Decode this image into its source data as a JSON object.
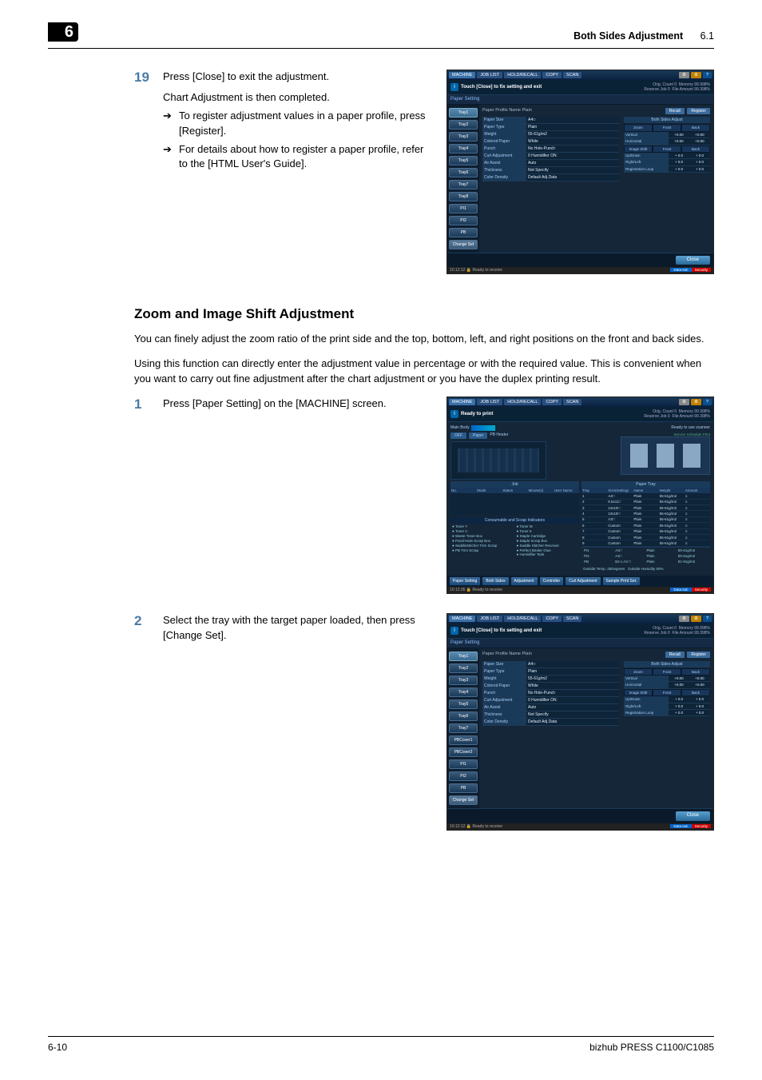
{
  "header": {
    "title": "Both Sides Adjustment",
    "section": "6.1"
  },
  "chapter_tab": "6",
  "footer": {
    "page": "6-10",
    "product": "bizhub PRESS C1100/C1085"
  },
  "step19": {
    "num": "19",
    "line1": "Press [Close] to exit the adjustment.",
    "line2": "Chart Adjustment is then completed.",
    "bullet1": "To register adjustment values in a paper profile, press [Register].",
    "bullet2": "For details about how to register a paper profile, refer to the [HTML User's Guide]."
  },
  "section_title": "Zoom and Image Shift Adjustment",
  "para1": "You can finely adjust the zoom ratio of the print side and the top, bottom, left, and right positions on the front and back sides.",
  "para2": "Using this function can directly enter the adjustment value in percentage or with the required value. This is convenient when you want to carry out fine adjustment after the chart adjustment or you have the duplex printing result.",
  "step1": {
    "num": "1",
    "text": "Press [Paper Setting] on the [MACHINE] screen."
  },
  "step2": {
    "num": "2",
    "text": "Select the tray with the target paper loaded, then press [Change Set]."
  },
  "screen_common": {
    "tabs": {
      "machine": "MACHINE",
      "joblist": "JOB LIST",
      "recall": "HOLD/RECALL",
      "copy": "COPY",
      "scan": "SCAN",
      "util": "Utility",
      "help": "?"
    },
    "stats": {
      "orig_label": "Orig. Count",
      "orig_val": "0",
      "mem_label": "Memory",
      "mem_val": "99.998%",
      "res_label": "Reserve Job",
      "res_val": "0",
      "file_label": "File Amount",
      "file_val": "99.398%"
    },
    "status_time": "10:12:12",
    "status_text": "Ready to receive",
    "led_blue": "Data Ind.",
    "led_red": "Security"
  },
  "screen1": {
    "msg": "Touch [Close] to fix setting and exit",
    "section": "Paper Setting",
    "trays": [
      "Tray1",
      "Tray2",
      "Tray3",
      "Tray4",
      "Tray5",
      "Tray6",
      "Tray7",
      "Tray8",
      "PI1",
      "PI2",
      "PB"
    ],
    "change_set": "Change Set",
    "profile_label": "Paper Profile Name",
    "profile_value": "Plain",
    "recall_btn": "Recall",
    "register_btn": "Register",
    "rows": [
      {
        "k": "Paper Size",
        "v": "A4□"
      },
      {
        "k": "Paper Type",
        "v": "Plain"
      },
      {
        "k": "Weight",
        "v": "55-61g/m2"
      },
      {
        "k": "Colored Paper",
        "v": "White"
      },
      {
        "k": "Punch",
        "v": "No Hole-Punch"
      },
      {
        "k": "Curl Adjustment",
        "v": "0 Humidifier ON"
      },
      {
        "k": "Air Assist",
        "v": "Auto"
      },
      {
        "k": "Thickness",
        "v": "Not Specify"
      },
      {
        "k": "Color Density",
        "v": "Default Adj.Data"
      }
    ],
    "adjust": {
      "title": "Both Sides Adjust",
      "zoom_hdr": "Zoom",
      "front_hdr": "Front",
      "back_hdr": "Back",
      "rows_zoom": [
        {
          "lbl": "Vertical",
          "f": "+0.00",
          "b": "+0.00"
        },
        {
          "lbl": "Horizontal",
          "f": "+0.00",
          "b": "+0.00"
        }
      ],
      "shift_hdr": "Image Shift",
      "rows_shift": [
        {
          "lbl": "Up/Down",
          "f": "+ 0.0",
          "b": "+ 0.0"
        },
        {
          "lbl": "Right/Left",
          "f": "+ 0.0",
          "b": "+ 0.0"
        },
        {
          "lbl": "Registration Loop",
          "f": "+ 0.0",
          "b": "+ 0.0"
        }
      ]
    },
    "close_btn": "Close"
  },
  "screen2": {
    "msg": "Ready to print",
    "main_body_label": "Main Body",
    "heater_btn1": "OFF",
    "heater_btn2": "Paper",
    "heater_label": "PB Heater",
    "scanner_msg": "Ready to use scanner",
    "schedule_btn": "Service Schedule Print",
    "joblist": {
      "hdr": "Job",
      "cols": [
        "No.",
        "Mode",
        "Status",
        "Minute(s)",
        "User Name"
      ]
    },
    "papertray": {
      "hdr": "Paper Tray",
      "cols": [
        "Tray",
        "Size(Setting)",
        "Name",
        "Weight",
        "Amount"
      ],
      "rows": [
        {
          "t": "1",
          "s": "A4□",
          "n": "Plain",
          "w": "55-61g/m2"
        },
        {
          "t": "2",
          "s": "8.5x11□",
          "n": "Plain",
          "w": "55-61g/m2"
        },
        {
          "t": "3",
          "s": "13x19□",
          "n": "Plain",
          "w": "55-61g/m2"
        },
        {
          "t": "4",
          "s": "13x19□",
          "n": "Plain",
          "w": "55-61g/m2"
        },
        {
          "t": "5",
          "s": "A3□",
          "n": "Plain",
          "w": "55-61g/m2"
        },
        {
          "t": "6",
          "s": "Custom",
          "n": "Plain",
          "w": "55-61g/m2"
        },
        {
          "t": "7",
          "s": "Custom",
          "n": "Plain",
          "w": "55-61g/m2"
        },
        {
          "t": "8",
          "s": "Custom",
          "n": "Plain",
          "w": "55-61g/m2"
        },
        {
          "t": "9",
          "s": "Custom",
          "n": "Plain",
          "w": "55-61g/m2"
        }
      ],
      "pi_rows": [
        {
          "t": "PI1",
          "s": "A4□",
          "n": "Plain",
          "w": "55-61g/m2"
        },
        {
          "t": "PI2",
          "s": "A4□",
          "n": "Plain",
          "w": "55-61g/m2"
        },
        {
          "t": "PB",
          "s": "B4 x A3 □",
          "n": "Plain",
          "w": "81-91g/m2"
        }
      ]
    },
    "consumable_hdr": "Consumable and Scrap Indicators",
    "consumables_left": [
      "Toner Y",
      "Toner C",
      "Waste Toner Box",
      "PunchHole Scrap Box",
      "SaddleStitcher Trim Scrap",
      "PB Trim Scrap"
    ],
    "consumables_right": [
      "Toner M",
      "Toner K",
      "Staple Cartridge",
      "Staple Scrap Box",
      "Saddle Stitcher Receiver",
      "Perfect Binder Glue",
      "Humidifier Tank"
    ],
    "outside": {
      "temp_lbl": "Outside Temp.",
      "temp_val": "25Degrees",
      "hum_lbl": "Outside Humidity",
      "hum_val": "50%"
    },
    "bottom_btns": [
      "Paper Setting",
      "Both Sides",
      "Adjustment",
      "Controller",
      "Curl Adjustment",
      "Sample Print Set."
    ]
  },
  "screen3_extra_trays": [
    "PBCover1",
    "PBCover2"
  ]
}
